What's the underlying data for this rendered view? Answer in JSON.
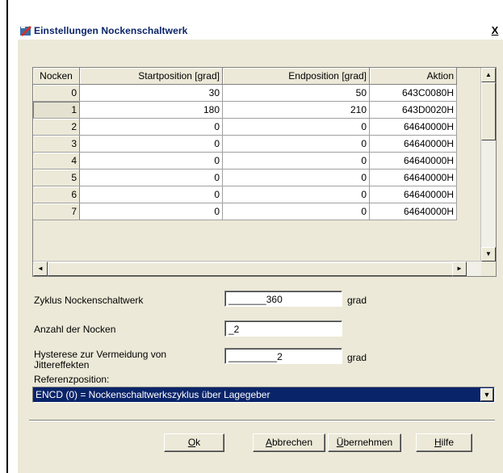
{
  "window": {
    "title": "Einstellungen Nockenschaltwerk",
    "close_label": "X"
  },
  "grid": {
    "columns": [
      "Nocken",
      "Startposition [grad]",
      "Endposition [grad]",
      "Aktion"
    ],
    "rows": [
      {
        "nocken": "0",
        "start": "30",
        "end": "50",
        "aktion": "643C0080H"
      },
      {
        "nocken": "1",
        "start": "180",
        "end": "210",
        "aktion": "643D0020H"
      },
      {
        "nocken": "2",
        "start": "0",
        "end": "0",
        "aktion": "64640000H"
      },
      {
        "nocken": "3",
        "start": "0",
        "end": "0",
        "aktion": "64640000H"
      },
      {
        "nocken": "4",
        "start": "0",
        "end": "0",
        "aktion": "64640000H"
      },
      {
        "nocken": "5",
        "start": "0",
        "end": "0",
        "aktion": "64640000H"
      },
      {
        "nocken": "6",
        "start": "0",
        "end": "0",
        "aktion": "64640000H"
      },
      {
        "nocken": "7",
        "start": "0",
        "end": "0",
        "aktion": "64640000H"
      }
    ],
    "selected_row": "1",
    "up_arrow": "▲",
    "down_arrow": "▼",
    "left_arrow": "◄",
    "right_arrow": "►"
  },
  "settings": {
    "zyklus_label": "Zyklus Nockenschaltwerk",
    "zyklus_value": "_______360",
    "zyklus_unit": "grad",
    "anzahl_label": "Anzahl der Nocken",
    "anzahl_value": "_2",
    "hysterese_label_line1": "Hysterese zur Vermeidung von",
    "hysterese_label_line2": "Jittereffekten",
    "hysterese_value": "_________2",
    "hysterese_unit": "grad",
    "referenz_label": "Referenzposition:",
    "referenz_value": "ENCD (0) = Nockenschaltwerkszyklus über Lagegeber",
    "dropdown_arrow": "▼"
  },
  "buttons": {
    "ok_accel": "O",
    "ok_rest": "k",
    "cancel_accel": "A",
    "cancel_rest": "bbrechen",
    "apply_accel": "Ü",
    "apply_rest": "bernehmen",
    "help_accel": "H",
    "help_rest": "ilfe"
  },
  "colors": {
    "dialog_bg": "#ece9d8",
    "selection": "#0a246a",
    "title_text": "#0a246a"
  },
  "icons": {
    "title_icon": "app-icon",
    "close": "close-icon"
  }
}
